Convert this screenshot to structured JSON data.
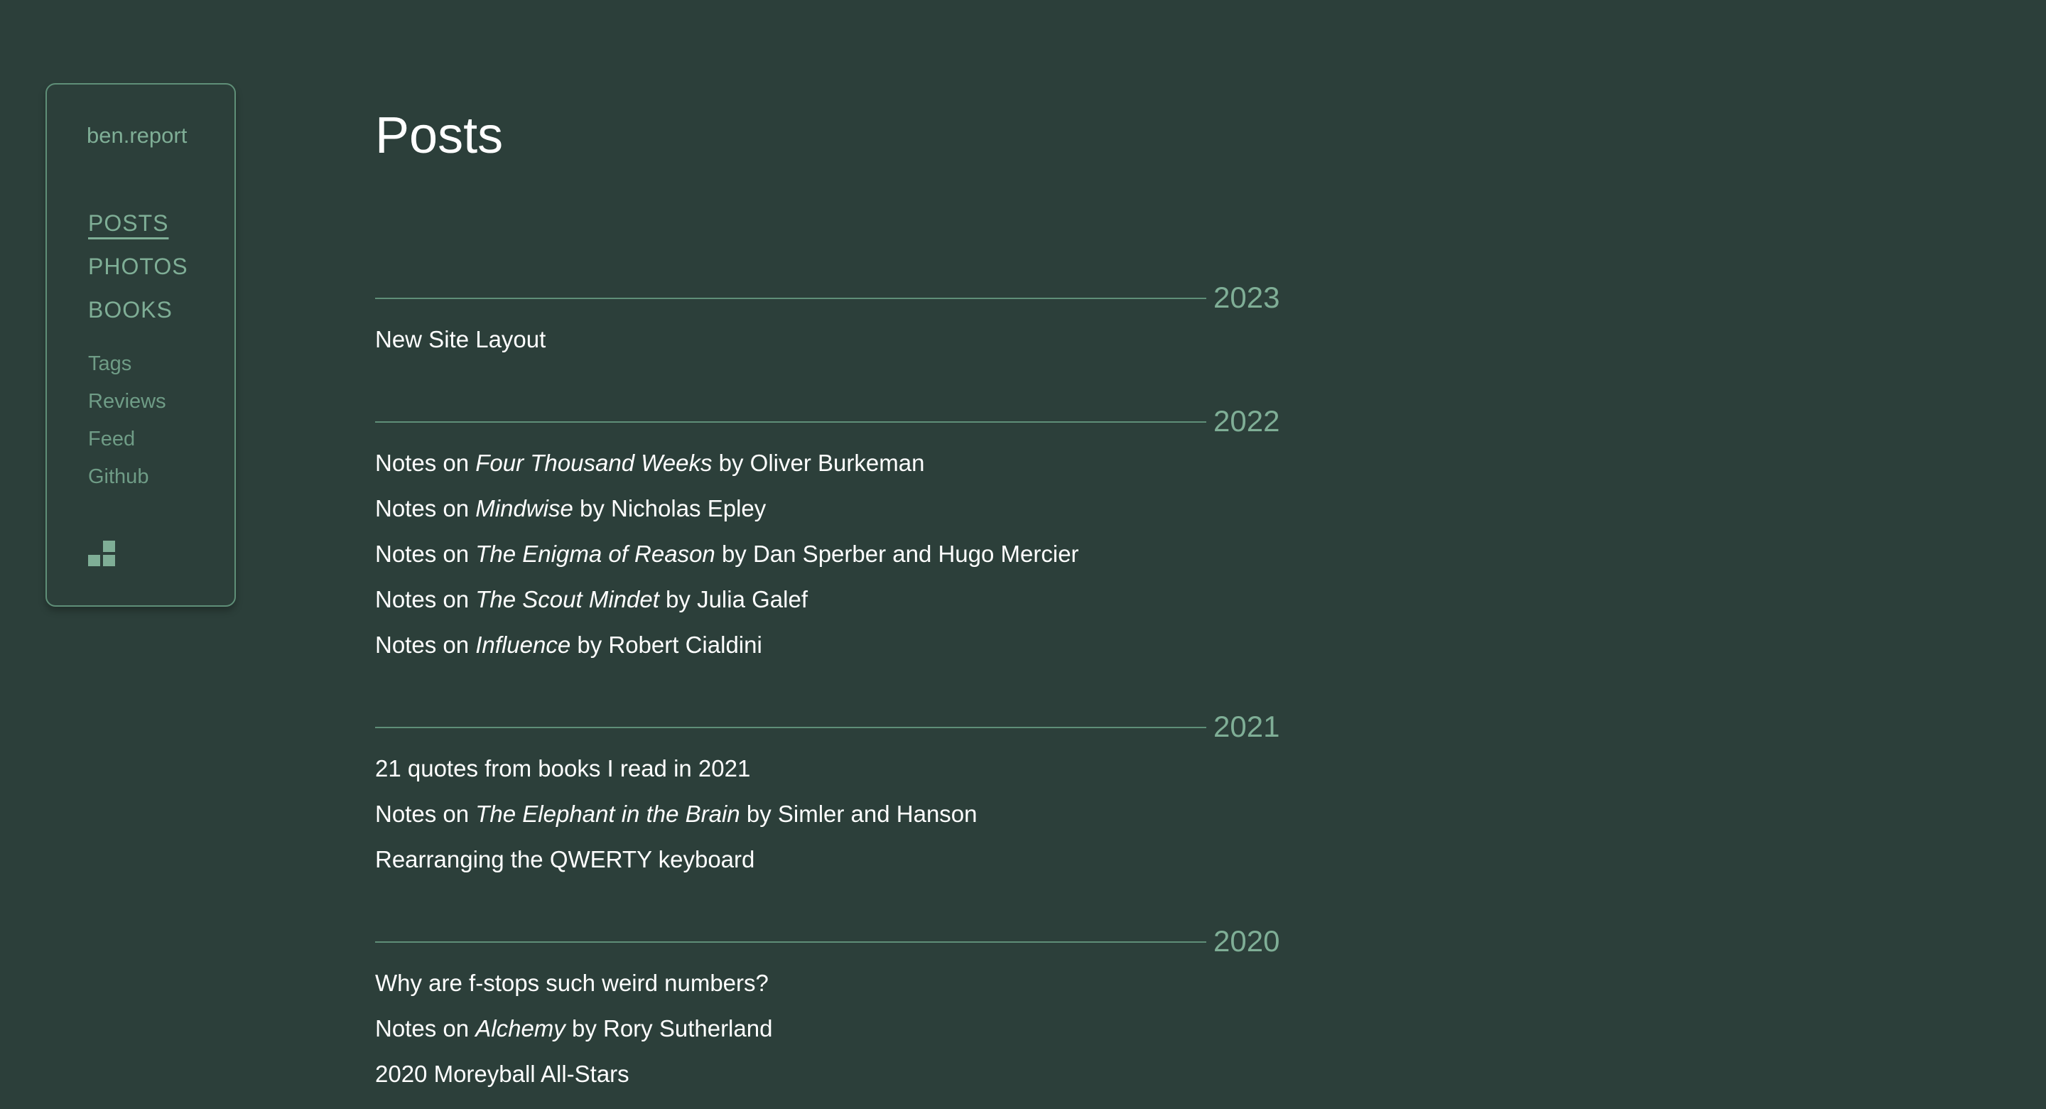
{
  "sidebar": {
    "brand": "ben.report",
    "nav_main": [
      {
        "label": "POSTS",
        "active": true
      },
      {
        "label": "PHOTOS",
        "active": false
      },
      {
        "label": "BOOKS",
        "active": false
      }
    ],
    "nav_sub": [
      {
        "label": "Tags"
      },
      {
        "label": "Reviews"
      },
      {
        "label": "Feed"
      },
      {
        "label": "Github"
      }
    ],
    "logo_icon": "stacked-blocks-icon"
  },
  "main": {
    "title": "Posts",
    "years": [
      {
        "year": "2023",
        "posts": [
          {
            "prefix": "New Site Layout",
            "title": "",
            "suffix": ""
          }
        ]
      },
      {
        "year": "2022",
        "posts": [
          {
            "prefix": "Notes on ",
            "title": "Four Thousand Weeks",
            "suffix": " by Oliver Burkeman"
          },
          {
            "prefix": "Notes on ",
            "title": "Mindwise",
            "suffix": " by Nicholas Epley"
          },
          {
            "prefix": "Notes on ",
            "title": "The Enigma of Reason",
            "suffix": " by Dan Sperber and Hugo Mercier"
          },
          {
            "prefix": "Notes on ",
            "title": "The Scout Mindet",
            "suffix": " by Julia Galef"
          },
          {
            "prefix": "Notes on ",
            "title": "Influence",
            "suffix": " by Robert Cialdini"
          }
        ]
      },
      {
        "year": "2021",
        "posts": [
          {
            "prefix": "21 quotes from books I read in 2021",
            "title": "",
            "suffix": ""
          },
          {
            "prefix": "Notes on ",
            "title": "The Elephant in the Brain",
            "suffix": " by Simler and Hanson"
          },
          {
            "prefix": "Rearranging the QWERTY keyboard",
            "title": "",
            "suffix": ""
          }
        ]
      },
      {
        "year": "2020",
        "posts": [
          {
            "prefix": "Why are f-stops such weird numbers?",
            "title": "",
            "suffix": ""
          },
          {
            "prefix": "Notes on ",
            "title": "Alchemy",
            "suffix": " by Rory Sutherland"
          },
          {
            "prefix": "2020 Moreyball All-Stars",
            "title": "",
            "suffix": ""
          }
        ]
      }
    ]
  },
  "colors": {
    "background": "#2c3f3a",
    "accent": "#7fae96",
    "text": "#ffffff"
  }
}
